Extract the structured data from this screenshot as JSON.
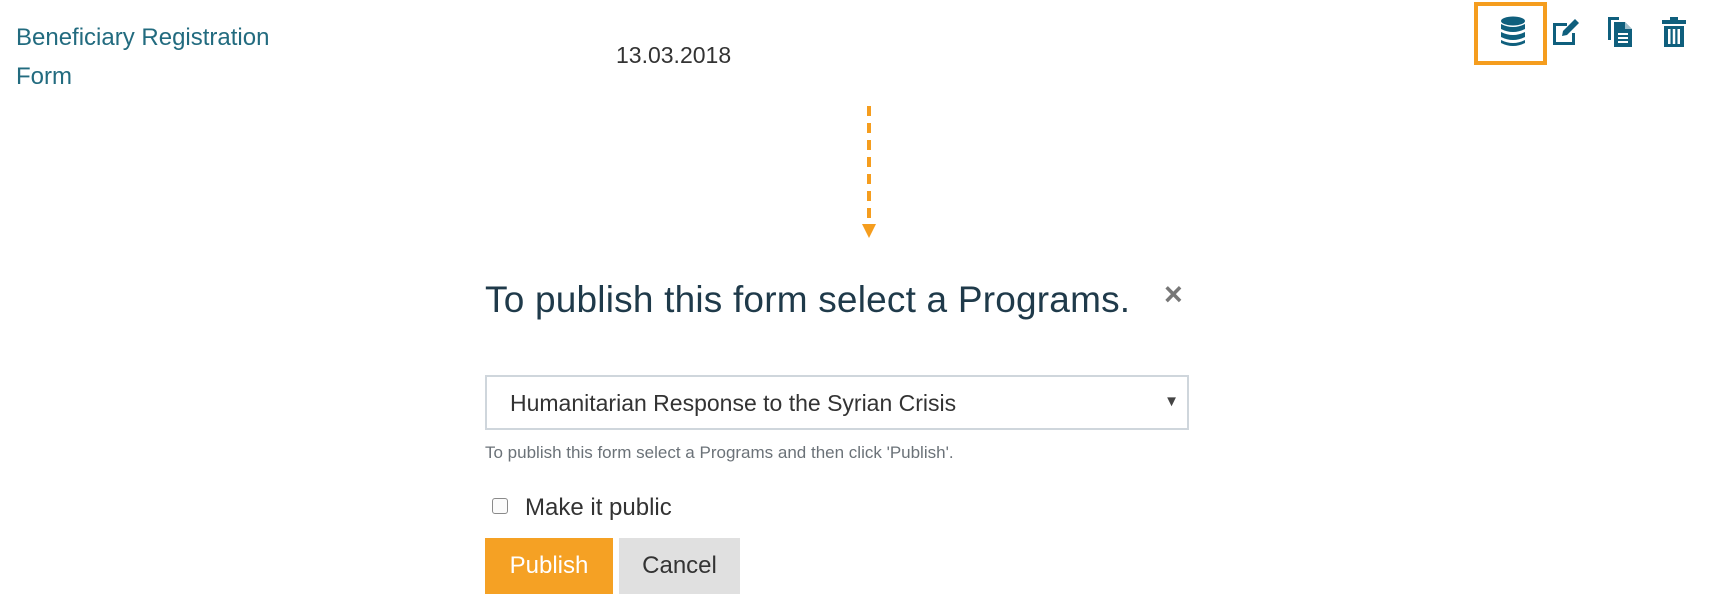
{
  "row": {
    "form_name": "Beneficiary Registration Form",
    "date": "13.03.2018",
    "actions": [
      {
        "icon": "database-icon",
        "highlighted": true
      },
      {
        "icon": "edit-icon"
      },
      {
        "icon": "copy-icon"
      },
      {
        "icon": "trash-icon"
      }
    ]
  },
  "modal": {
    "title": "To publish this form select a Programs.",
    "close_label": "×",
    "program_select": {
      "selected": "Humanitarian Response to the Syrian Crisis"
    },
    "help_text": "To publish this form select a Programs and then click 'Publish'.",
    "make_public_label": "Make it public",
    "make_public_checked": false,
    "publish_label": "Publish",
    "cancel_label": "Cancel"
  },
  "colors": {
    "link": "#226b7f",
    "icon": "#0f5f7d",
    "highlight": "#f59d1e",
    "publish_button": "#f5a124",
    "cancel_button": "#e0e0e0"
  }
}
